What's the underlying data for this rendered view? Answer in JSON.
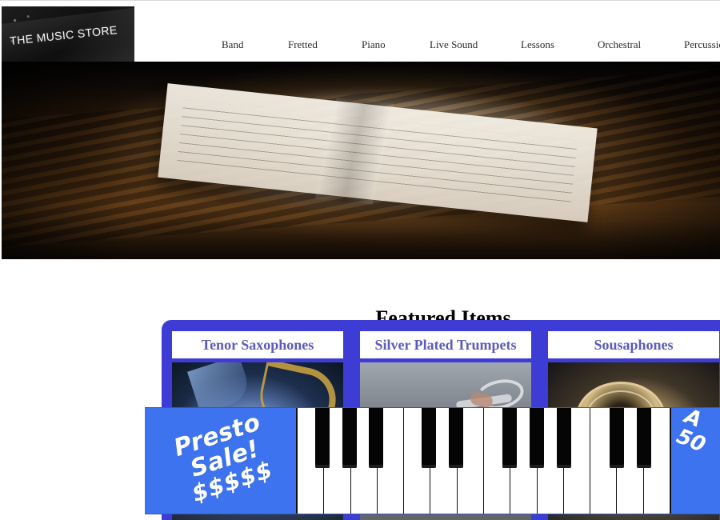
{
  "header": {
    "logo_text": "THE MUSIC STORE",
    "nav_items": [
      "Band",
      "Fretted",
      "Piano",
      "Live Sound",
      "Lessons",
      "Orchestral",
      "Percussion"
    ]
  },
  "featured": {
    "title": "Featured Items",
    "cards": [
      {
        "title": "Tenor Saxophones"
      },
      {
        "title": "Silver Plated Trumpets"
      },
      {
        "title": "Sousaphones"
      }
    ]
  },
  "banner": {
    "left_line_1": "Presto Sale!",
    "left_line_2": "$$$$$",
    "right_text_line_1": "A",
    "right_text_line_2": "50"
  },
  "colors": {
    "featured_panel": "#3d3dd5",
    "card_title_text": "#5b5bbf",
    "banner_blue": "#3d73ef"
  }
}
